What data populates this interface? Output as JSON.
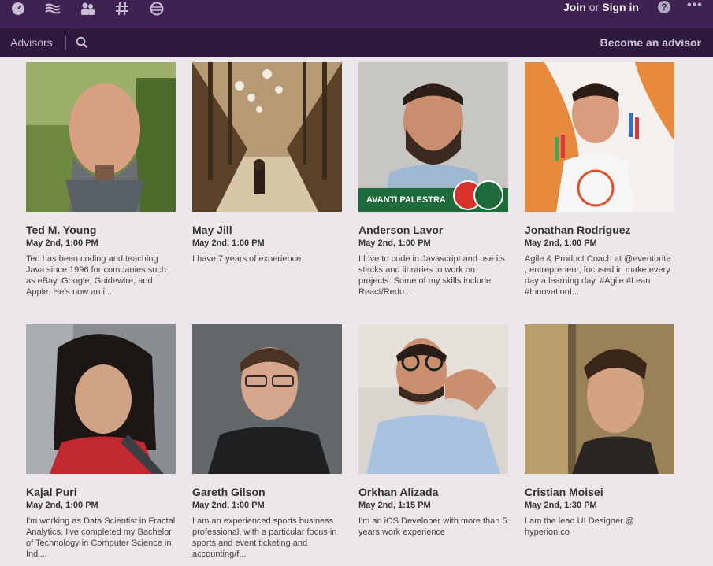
{
  "topbar": {
    "nav_icons": [
      "gauge-icon",
      "waves-icon",
      "people-icon",
      "hashtag-icon",
      "globe-icon"
    ],
    "join_label": "Join",
    "or_label": "or",
    "signin_label": "Sign in",
    "help_label": "?",
    "more_label": "•••"
  },
  "subbar": {
    "title": "Advisors",
    "become_label": "Become an advisor"
  },
  "advisors": [
    {
      "name": "Ted M. Young",
      "date": "May 2nd, 1:00 PM",
      "bio": "Ted has been coding and teaching Java since 1996 for companies such as eBay, Google, Guidewire, and Apple. He's now an i..."
    },
    {
      "name": "May Jill",
      "date": "May 2nd, 1:00 PM",
      "bio": "I have 7 years of experience."
    },
    {
      "name": "Anderson Lavor",
      "date": "May 2nd, 1:00 PM",
      "bio": "I love to code in Javascript and use its stacks and libraries to work on projects. Some of my skills include React/Redu...",
      "photo_caption": "AVANTI PALESTRA"
    },
    {
      "name": "Jonathan Rodriguez",
      "date": "May 2nd, 1:00 PM",
      "bio": "Agile & Product Coach at @eventbrite , entrepreneur, focused in make every day a learning day. #Agile #Lean #InnovationI..."
    },
    {
      "name": "Kajal Puri",
      "date": "May 2nd, 1:00 PM",
      "bio": "I'm working as Data Scientist in Fractal Analytics. I've completed my Bachelor of Technology in Computer Science in Indi..."
    },
    {
      "name": "Gareth Gilson",
      "date": "May 2nd, 1:00 PM",
      "bio": "I am an experienced sports business professional, with a particular focus in sports and event ticketing and accounting/f..."
    },
    {
      "name": "Orkhan Alizada",
      "date": "May 2nd, 1:15 PM",
      "bio": "I'm an iOS Developer with more than 5 years work experience"
    },
    {
      "name": "Cristian Moisei",
      "date": "May 2nd, 1:30 PM",
      "bio": "I am the lead UI Designer @ hyperion.co"
    }
  ],
  "colors": {
    "topbar": "#3f2252",
    "subbar": "#2d1a3c",
    "page": "#ece7ea"
  }
}
